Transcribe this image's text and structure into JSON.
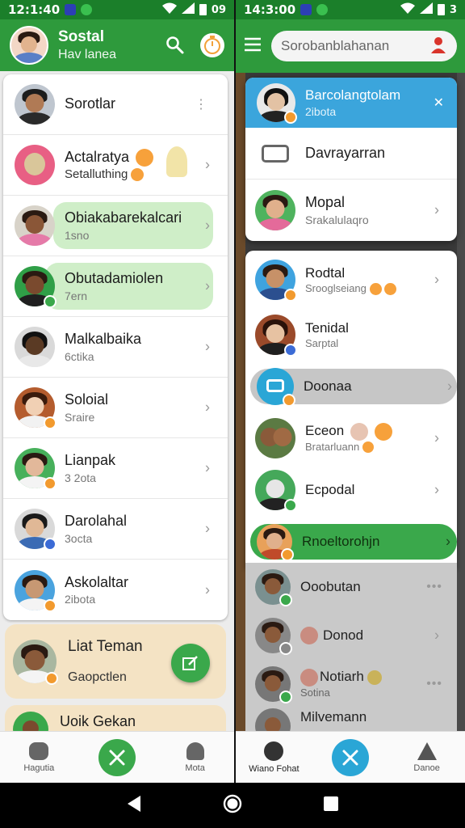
{
  "left": {
    "status": {
      "time": "12:1:40",
      "battery": "09"
    },
    "appbar": {
      "title": "Sostal",
      "subtitle": "Hav lanea"
    },
    "chats": [
      {
        "name": "Sorotlar",
        "sub": ""
      },
      {
        "name": "Actalratya",
        "sub": "Setalluthing"
      },
      {
        "name": "Obiakabarekalcari",
        "sub": "1sno"
      },
      {
        "name": "Obutadamiolen",
        "sub": "7ern"
      },
      {
        "name": "Malkalbaika",
        "sub": "6ctika"
      },
      {
        "name": "Soloial",
        "sub": "Sraire"
      },
      {
        "name": "Lianpak",
        "sub": "3 2ota"
      },
      {
        "name": "Darolahal",
        "sub": "3octa"
      },
      {
        "name": "Askolaltar",
        "sub": "2ibota"
      }
    ],
    "promo": {
      "title": "Liat Teman",
      "sub": "Gaopctlen",
      "next": "Uoik Gekan"
    },
    "nav": [
      {
        "label": "Hagutia"
      },
      {
        "label": ""
      },
      {
        "label": "Mota"
      }
    ]
  },
  "right": {
    "status": {
      "time": "14:3:00",
      "battery": "3"
    },
    "search": {
      "placeholder": "Sorobanblahanan"
    },
    "popup": {
      "header": {
        "name": "Barcolangtolam",
        "sub": "2ibota"
      },
      "action_label": "Davrayarran",
      "contact": {
        "name": "Mopal",
        "sub": "Srakalulaqro"
      }
    },
    "chats": [
      {
        "name": "Rodtal",
        "sub": "Srooglseiang"
      },
      {
        "name": "Tenidal",
        "sub": "Sarptal"
      },
      {
        "name": "Doonaa",
        "sub": ""
      },
      {
        "name": "Eceon",
        "sub": "Bratarluann"
      },
      {
        "name": "Ecpodal",
        "sub": ""
      },
      {
        "name": "Rnoeltorohjn",
        "sub": ""
      }
    ],
    "dimmed": [
      {
        "name": "Ooobutan",
        "sub": ""
      },
      {
        "name": "Donod",
        "sub": ""
      },
      {
        "name": "Notiarh",
        "sub": "Sotina"
      },
      {
        "name": "Milvemann",
        "sub": ""
      }
    ],
    "nav": [
      {
        "label": "Wiano Fohat"
      },
      {
        "label": ""
      },
      {
        "label": "Danoe"
      }
    ]
  },
  "colors": {
    "primary": "#2e9a3c",
    "statusbar": "#1b7f2a",
    "popup_header": "#3ba5dc",
    "highlight_green": "#cfeec8",
    "highlight_blue": "#3ba5dc",
    "promo_bg": "#f4e3c4",
    "fab": "#3aa84b"
  },
  "icons": {
    "left_appbar": [
      "search-icon",
      "timer-icon"
    ],
    "right_appbar": [
      "menu-icon",
      "user-icon"
    ],
    "system": [
      "back-icon",
      "home-icon",
      "recents-icon"
    ]
  }
}
